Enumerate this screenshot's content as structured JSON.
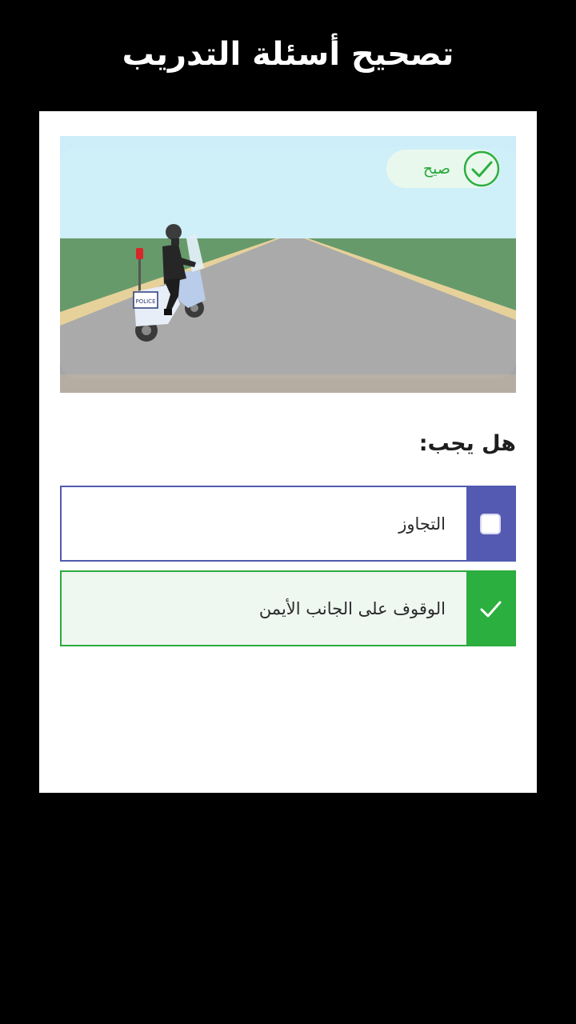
{
  "header": {
    "title": "تصحيح أسئلة التدريب"
  },
  "question_card": {
    "image": {
      "description_icon": "police-motorcycle-illustration",
      "police_text": "POLICE"
    },
    "result_badge": {
      "label": "صيح",
      "icon": "check-circle-icon",
      "color": "#27a83b"
    },
    "question_text": "هل يجب:",
    "answers": [
      {
        "label": "التجاوز",
        "state": "unchecked",
        "icon": "checkbox-icon",
        "color": "#5459b1"
      },
      {
        "label": "الوقوف على الجانب الأيمن",
        "state": "correct",
        "icon": "checkmark-icon",
        "color": "#2baf3e"
      }
    ]
  }
}
